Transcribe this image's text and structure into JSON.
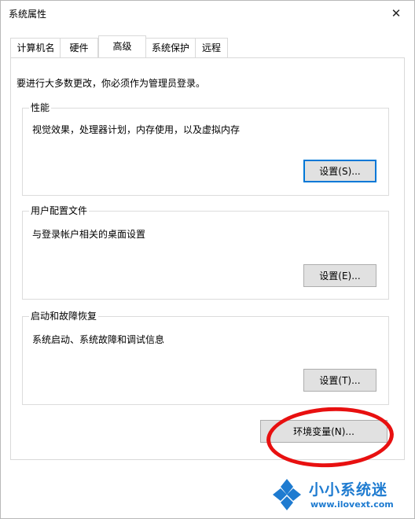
{
  "window": {
    "title": "系统属性",
    "close_glyph": "✕"
  },
  "tabs": [
    {
      "label": "计算机名"
    },
    {
      "label": "硬件"
    },
    {
      "label": "高级",
      "active": true
    },
    {
      "label": "系统保护"
    },
    {
      "label": "远程"
    }
  ],
  "notice": "要进行大多数更改，你必须作为管理员登录。",
  "groups": {
    "performance": {
      "title": "性能",
      "desc": "视觉效果，处理器计划，内存使用，以及虚拟内存",
      "button": "设置(S)..."
    },
    "profile": {
      "title": "用户配置文件",
      "desc": "与登录帐户相关的桌面设置",
      "button": "设置(E)..."
    },
    "startup": {
      "title": "启动和故障恢复",
      "desc": "系统启动、系统故障和调试信息",
      "button": "设置(T)..."
    }
  },
  "env_button": "环境变量(N)...",
  "watermark": {
    "title": "小小系统迷",
    "url": "www.ilovext.com",
    "logo_color": "#1e7bd0"
  },
  "annotation_color": "#e81010",
  "accent_color": "#0078d7"
}
